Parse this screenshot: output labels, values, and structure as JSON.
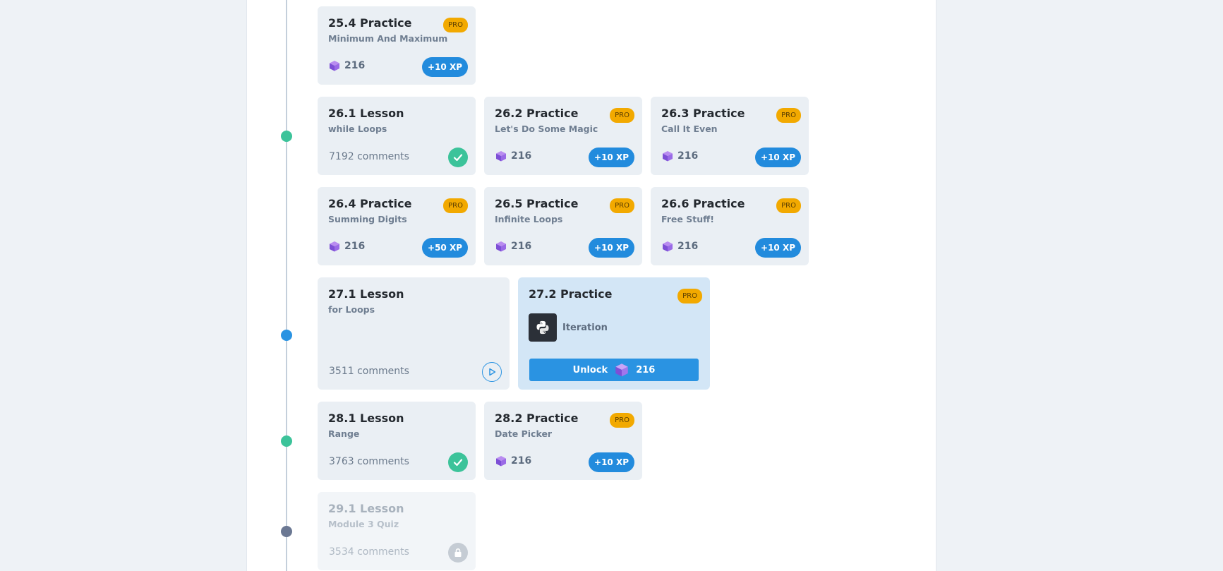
{
  "cards": {
    "c25_4": {
      "title": "25.4 Practice",
      "subtitle": "Minimum And Maximum",
      "badge": "PRO",
      "gems": "216",
      "xp": "+10 XP"
    },
    "c26_1": {
      "title": "26.1 Lesson",
      "subtitle": "while Loops",
      "comments": "7192 comments",
      "status": "completed"
    },
    "c26_2": {
      "title": "26.2 Practice",
      "subtitle": "Let's Do Some Magic",
      "badge": "PRO",
      "gems": "216",
      "xp": "+10 XP"
    },
    "c26_3": {
      "title": "26.3 Practice",
      "subtitle": "Call It Even",
      "badge": "PRO",
      "gems": "216",
      "xp": "+10 XP"
    },
    "c26_4": {
      "title": "26.4 Practice",
      "subtitle": "Summing Digits",
      "badge": "PRO",
      "gems": "216",
      "xp": "+50 XP"
    },
    "c26_5": {
      "title": "26.5 Practice",
      "subtitle": "Infinite Loops",
      "badge": "PRO",
      "gems": "216",
      "xp": "+10 XP"
    },
    "c26_6": {
      "title": "26.6 Practice",
      "subtitle": "Free Stuff!",
      "badge": "PRO",
      "gems": "216",
      "xp": "+10 XP"
    },
    "c27_1": {
      "title": "27.1 Lesson",
      "subtitle": "for Loops",
      "comments": "3511 comments",
      "status": "start"
    },
    "c27_2": {
      "title": "27.2 Practice",
      "badge": "PRO",
      "language_label": "Iteration",
      "unlock_label": "Unlock",
      "unlock_cost": "216"
    },
    "c28_1": {
      "title": "28.1 Lesson",
      "subtitle": "Range",
      "comments": "3763 comments",
      "status": "completed"
    },
    "c28_2": {
      "title": "28.2 Practice",
      "subtitle": "Date Picker",
      "badge": "PRO",
      "gems": "216",
      "xp": "+10 XP"
    },
    "c29_1": {
      "title": "29.1 Lesson",
      "subtitle": "Module 3 Quiz",
      "comments": "3534 comments",
      "status": "locked"
    }
  },
  "colors": {
    "completed": "#3cc39a",
    "current": "#2a93e2",
    "locked": "#6b7893",
    "pro_badge": "#f2a900",
    "xp_pill": "#228bdd"
  },
  "icons": {
    "gem": "purple-cube-icon",
    "completed": "check-icon",
    "start": "play-icon",
    "locked": "lock-icon",
    "language": "python-icon"
  }
}
